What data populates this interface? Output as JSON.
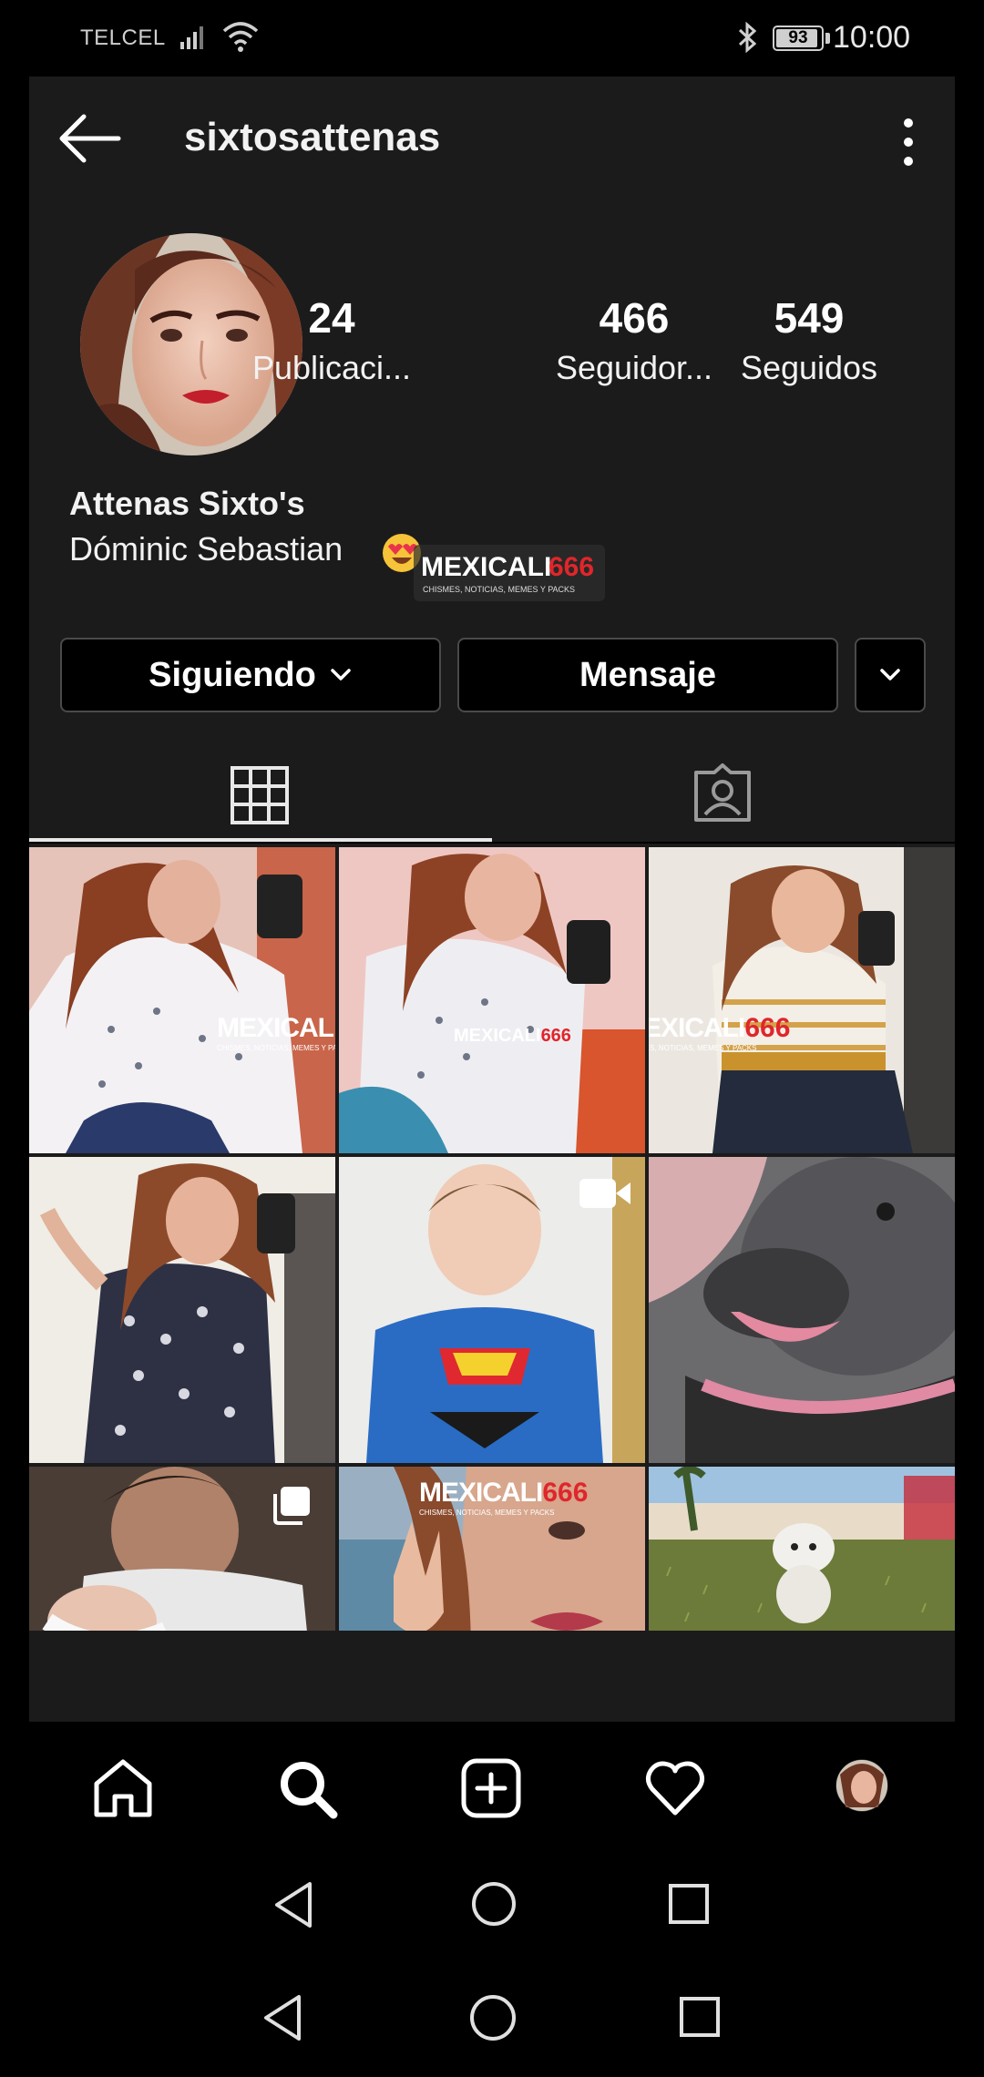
{
  "status_bar": {
    "carrier": "TELCEL",
    "battery": "93",
    "battery_level": 0.93,
    "time": "10:00"
  },
  "profile": {
    "username": "sixtosattenas",
    "full_name": "Attenas Sixto's",
    "bio": "Dóminic Sebastian",
    "stats": [
      {
        "value": "24",
        "label": "Publicaci..."
      },
      {
        "value": "466",
        "label": "Seguidor..."
      },
      {
        "value": "549",
        "label": "Seguidos"
      }
    ]
  },
  "actions": {
    "following_label": "Siguiendo",
    "message_label": "Mensaje"
  },
  "tabs": [
    {
      "icon": "grid-icon",
      "active": true
    },
    {
      "icon": "tagged-icon",
      "active": false
    }
  ],
  "watermark": {
    "brand_text": "MEXICALI",
    "brand_number": "666",
    "tagline": "CHISMES, NOTICIAS, MEMES Y PACKS"
  },
  "grid_posts": [
    {
      "icon": null
    },
    {
      "icon": null
    },
    {
      "icon": null
    },
    {
      "icon": null
    },
    {
      "icon": "video-icon"
    },
    {
      "icon": null
    },
    {
      "icon": "carousel-icon"
    },
    {
      "icon": null
    },
    {
      "icon": null
    }
  ],
  "bottom_nav": [
    "home-icon",
    "search-icon",
    "new-post-icon",
    "activity-icon",
    "profile-avatar"
  ],
  "system_nav": [
    "back-icon",
    "home-circle-icon",
    "recents-square-icon"
  ],
  "colors": {
    "app_background": "#1b1b1c",
    "button_border": "#4a4a4a",
    "watermark_number": "#e0262b"
  }
}
